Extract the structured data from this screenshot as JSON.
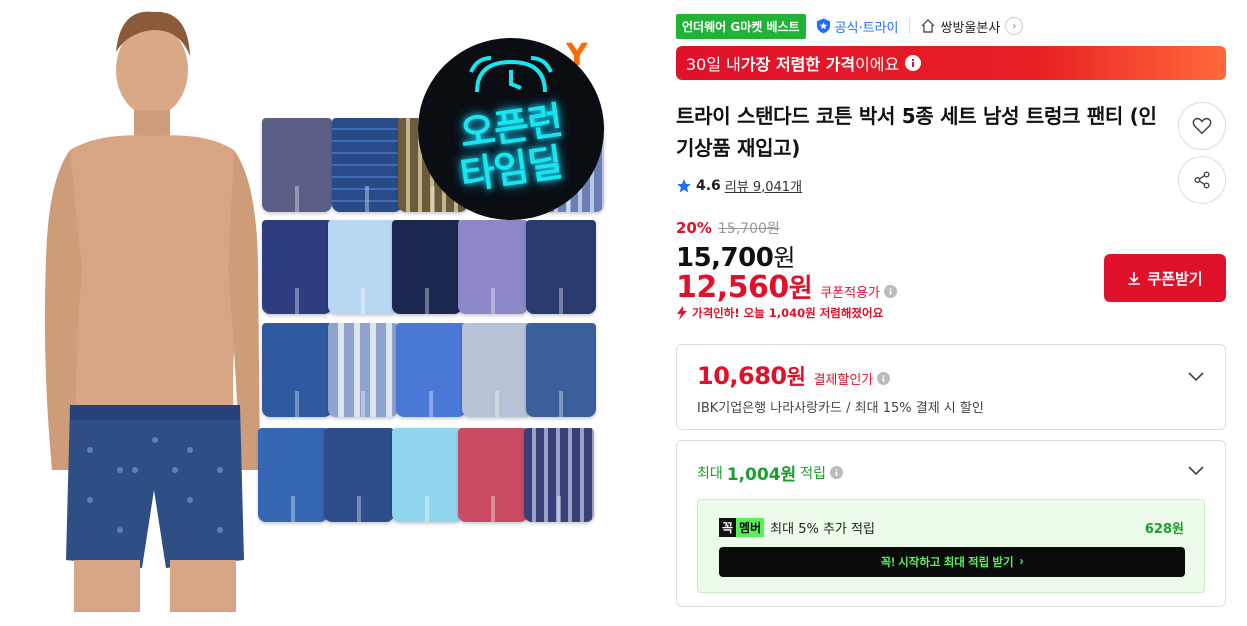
{
  "product_image": {
    "badge_line1": "오픈런",
    "badge_line2": "타임딜",
    "brand_corner": "Y"
  },
  "tags": {
    "best": "언더웨어 G마켓 베스트",
    "official": "공식·트라이",
    "store_name": "쌍방울본사"
  },
  "lowest_banner": {
    "prefix": "30일 내 ",
    "highlight": "가장 저렴한 가격",
    "suffix": "이에요"
  },
  "product": {
    "title": "트라이 스탠다드 코튼 박서 5종 세트 남성 트렁크 팬티 (인기상품 재입고)",
    "rating": "4.6",
    "review_label": "리뷰 9,041개"
  },
  "price": {
    "discount_rate": "20%",
    "original": "15,700원",
    "sale_amount": "15,700",
    "sale_unit": "원",
    "coupon_amount": "12,560",
    "coupon_unit": "원",
    "coupon_label": "쿠폰적용가",
    "price_down_note": "가격인하! 오늘 1,040원 저렴해졌어요",
    "coupon_button": "쿠폰받기"
  },
  "card_discount": {
    "amount": "10,680",
    "unit": "원",
    "label": "결제할인가",
    "desc": "IBK기업은행 나라사랑카드 / 최대 15% 결제 시 할인"
  },
  "points": {
    "prefix": "최대 ",
    "amount": "1,004원",
    "suffix": " 적립",
    "member_logo_1": "꼭",
    "member_logo_2": "멤버",
    "member_text": "최대 5% 추가 적립",
    "member_amount": "628원",
    "member_button": "꼭! 시작하고 최대 적립 받기"
  },
  "colors": {
    "accent_red": "#e1102b",
    "best_green": "#21b335",
    "point_green": "#1a9e2d",
    "official_blue": "#1e6ef7",
    "neon_cyan": "#17e6f0"
  },
  "icons": [
    "shield-icon",
    "home-icon",
    "chevron-right-icon",
    "info-icon",
    "heart-icon",
    "share-icon",
    "star-icon",
    "download-icon",
    "chevron-down-icon",
    "bolt-icon",
    "alarm-clock-icon"
  ]
}
